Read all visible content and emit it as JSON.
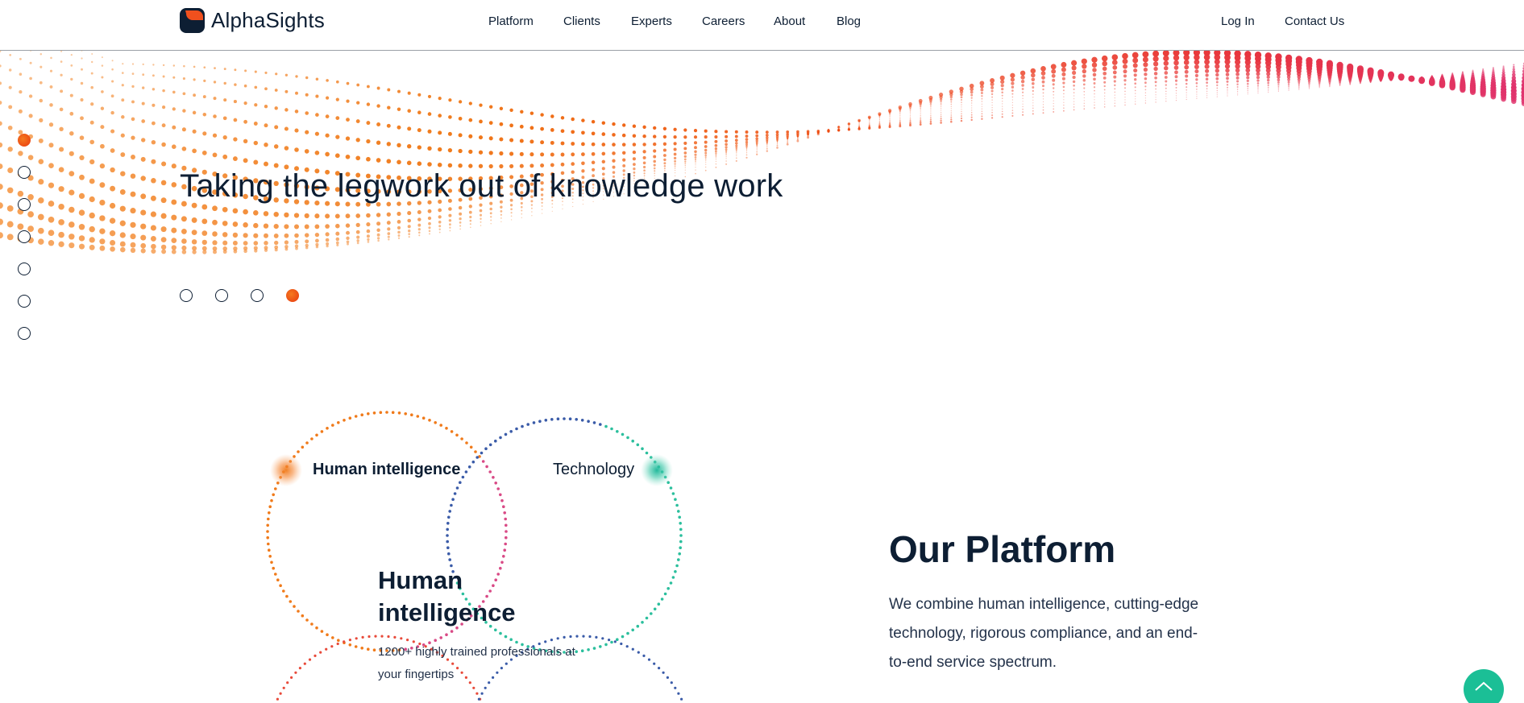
{
  "header": {
    "logo_text": "AlphaSights",
    "nav": [
      "Platform",
      "Clients",
      "Experts",
      "Careers",
      "About",
      "Blog"
    ],
    "log_in": "Log In",
    "contact_us": "Contact Us"
  },
  "hero": {
    "title": "Taking the legwork out of knowledge work",
    "side_nav_count": 7,
    "side_nav_active": 1,
    "slide_count": 4,
    "slide_active": 4
  },
  "venn": {
    "label_left": "Human intelligence",
    "label_right": "Technology",
    "title": "Human intelligence",
    "description": "1200+ highly trained professionals at your fingertips"
  },
  "platform": {
    "title": "Our Platform",
    "description": "We combine human intelligence, cutting-edge technology, rigorous compliance, and an end-to-end service spectrum."
  },
  "colors": {
    "navy": "#0d1e33",
    "orange": "#f0641e",
    "red": "#e8380f",
    "pink": "#e0336e",
    "teal": "#1bbf96",
    "blue": "#3a5ba8"
  },
  "icons": [
    "logo-mark-icon",
    "chevron-up-icon"
  ]
}
